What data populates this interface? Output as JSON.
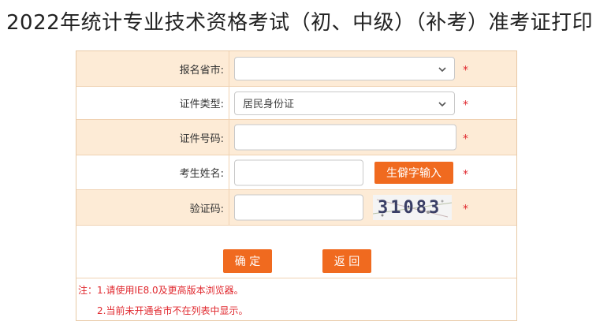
{
  "page": {
    "title": "2022年统计专业技术资格考试（初、中级）（补考）准考证打印"
  },
  "form": {
    "province": {
      "label": "报名省市:",
      "value": ""
    },
    "id_type": {
      "label": "证件类型:",
      "value": "居民身份证"
    },
    "id_number": {
      "label": "证件号码:",
      "value": ""
    },
    "name": {
      "label": "考生姓名:",
      "value": "",
      "rare_char_button": "生僻字输入"
    },
    "captcha": {
      "label": "验证码:",
      "value": "",
      "image_text": "31083"
    },
    "required_mark": "*"
  },
  "actions": {
    "confirm": "确 定",
    "back": "返 回"
  },
  "notes": {
    "line1": "注：1.请使用IE8.0及更高版本浏览器。",
    "line2": "2.当前未开通省市不在列表中显示。"
  },
  "colors": {
    "accent": "#f06a1f",
    "row_shade": "#fdebd6",
    "required": "#e0282e"
  }
}
